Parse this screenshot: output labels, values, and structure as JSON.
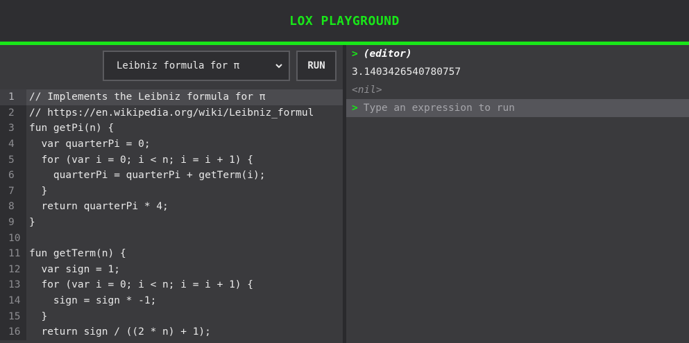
{
  "header": {
    "title": "LOX PLAYGROUND"
  },
  "toolbar": {
    "example_selected": "Leibniz formula for π",
    "run_label": "RUN"
  },
  "editor": {
    "lines": [
      {
        "num": "1",
        "code": "// Implements the Leibniz formula for π"
      },
      {
        "num": "2",
        "code": "// https://en.wikipedia.org/wiki/Leibniz_formul"
      },
      {
        "num": "3",
        "code": "fun getPi(n) {"
      },
      {
        "num": "4",
        "code": "  var quarterPi = 0;"
      },
      {
        "num": "5",
        "code": "  for (var i = 0; i < n; i = i + 1) {"
      },
      {
        "num": "6",
        "code": "    quarterPi = quarterPi + getTerm(i);"
      },
      {
        "num": "7",
        "code": "  }"
      },
      {
        "num": "8",
        "code": "  return quarterPi * 4;"
      },
      {
        "num": "9",
        "code": "}"
      },
      {
        "num": "10",
        "code": ""
      },
      {
        "num": "11",
        "code": "fun getTerm(n) {"
      },
      {
        "num": "12",
        "code": "  var sign = 1;"
      },
      {
        "num": "13",
        "code": "  for (var i = 0; i < n; i = i + 1) {"
      },
      {
        "num": "14",
        "code": "    sign = sign * -1;"
      },
      {
        "num": "15",
        "code": "  }"
      },
      {
        "num": "16",
        "code": "  return sign / ((2 * n) + 1);"
      }
    ]
  },
  "repl": {
    "prompt": ">",
    "source_label": "(editor)",
    "output": "3.1403426540780757",
    "result": "<nil>",
    "input_placeholder": "Type an expression to run",
    "input_value": ""
  },
  "colors": {
    "accent": "#19e619",
    "background": "#3a3a3d",
    "header_bg": "#2e2e31"
  }
}
